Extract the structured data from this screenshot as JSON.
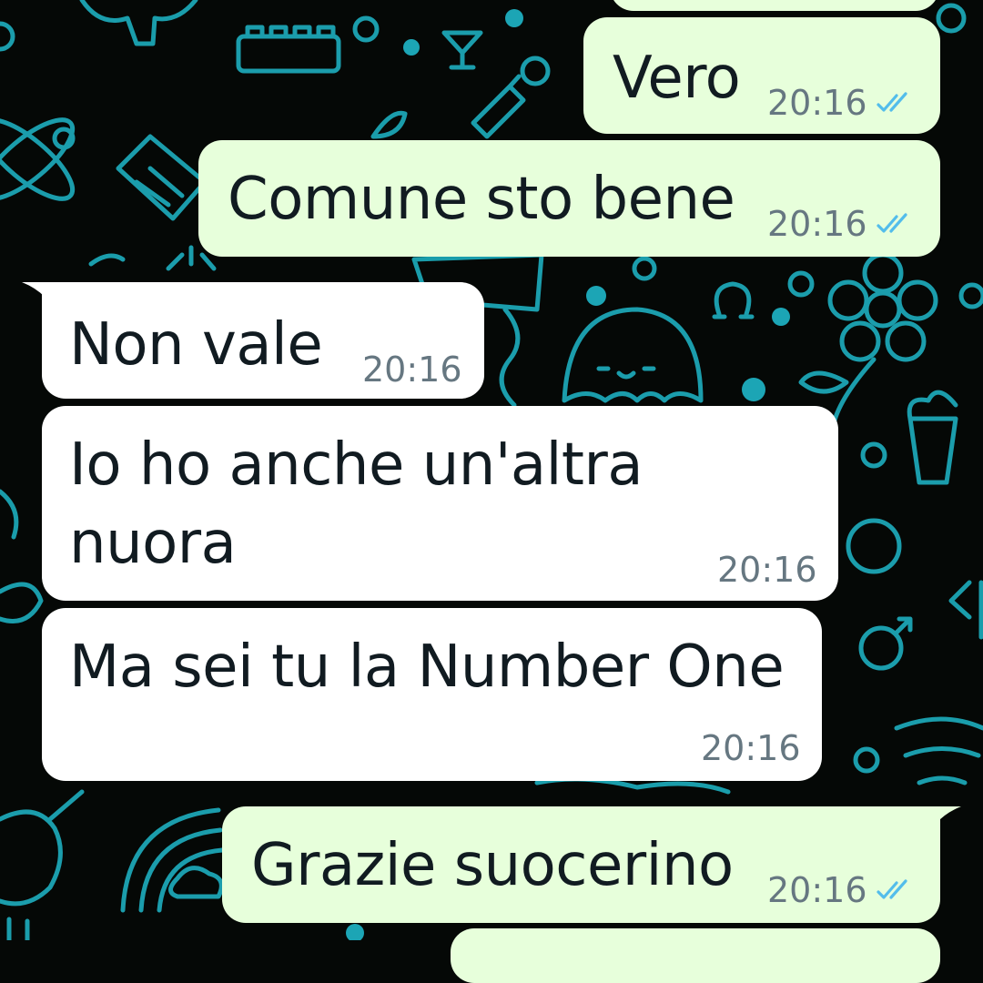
{
  "chat": {
    "messages": [
      {
        "id": "m1",
        "direction": "outgoing",
        "text": "Vero",
        "time": "20:16",
        "status": "read"
      },
      {
        "id": "m2",
        "direction": "outgoing",
        "text": "Comune sto bene",
        "time": "20:16",
        "status": "read"
      },
      {
        "id": "m3",
        "direction": "incoming",
        "text": "Non vale",
        "time": "20:16"
      },
      {
        "id": "m4",
        "direction": "incoming",
        "text_line1": "Io ho anche un'altra",
        "text_line2": "nuora",
        "time": "20:16"
      },
      {
        "id": "m5",
        "direction": "incoming",
        "text": "Ma sei tu la Number One",
        "time": "20:16"
      },
      {
        "id": "m6",
        "direction": "outgoing",
        "text": "Grazie suocerino",
        "time": "20:16",
        "status": "read"
      }
    ]
  },
  "colors": {
    "outgoing_bubble": "#e7ffdb",
    "incoming_bubble": "#ffffff",
    "read_ticks": "#53bdeb",
    "timestamp": "#667781",
    "wallpaper_background": "#050806",
    "wallpaper_doodles": "#1fb7c9"
  },
  "icons": {
    "read_receipt": "double-check-icon"
  }
}
